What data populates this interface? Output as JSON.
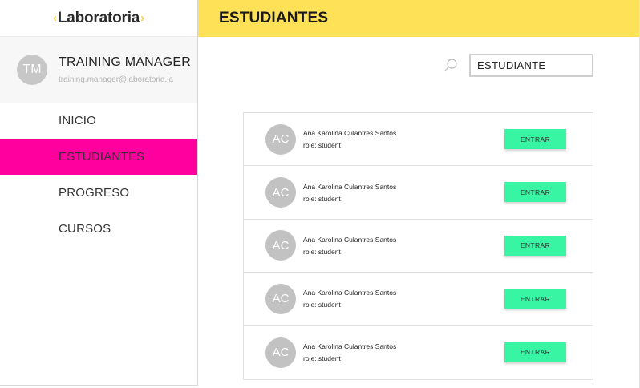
{
  "logo": {
    "bracket_left": "‹",
    "text": "Laboratoria",
    "bracket_right": "›"
  },
  "profile": {
    "initials": "TM",
    "name": "TRAINING MANAGER",
    "email": "training.manager@laboratoria.la"
  },
  "nav": {
    "items": [
      {
        "label": "INICIO",
        "active": false
      },
      {
        "label": "ESTUDIANTES",
        "active": true
      },
      {
        "label": "PROGRESO",
        "active": false
      },
      {
        "label": "CURSOS",
        "active": false
      }
    ]
  },
  "header": {
    "title": "ESTUDIANTES"
  },
  "search": {
    "value": "ESTUDIANTE",
    "icon": "search-icon"
  },
  "students": [
    {
      "initials": "AC",
      "name": "Ana Karolina Culantres Santos",
      "role": "role: student",
      "button": "ENTRAR"
    },
    {
      "initials": "AC",
      "name": "Ana Karolina Culantres Santos",
      "role": "role: student",
      "button": "ENTRAR"
    },
    {
      "initials": "AC",
      "name": "Ana Karolina Culantres Santos",
      "role": "role: student",
      "button": "ENTRAR"
    },
    {
      "initials": "AC",
      "name": "Ana Karolina Culantres Santos",
      "role": "role: student",
      "button": "ENTRAR"
    },
    {
      "initials": "AC",
      "name": "Ana Karolina Culantres Santos",
      "role": "role: student",
      "button": "ENTRAR"
    }
  ],
  "colors": {
    "header_bg": "#ffe158",
    "active_nav": "#ff009e",
    "button_bg": "#37f5a2",
    "logo_bracket": "#ffd23f"
  }
}
